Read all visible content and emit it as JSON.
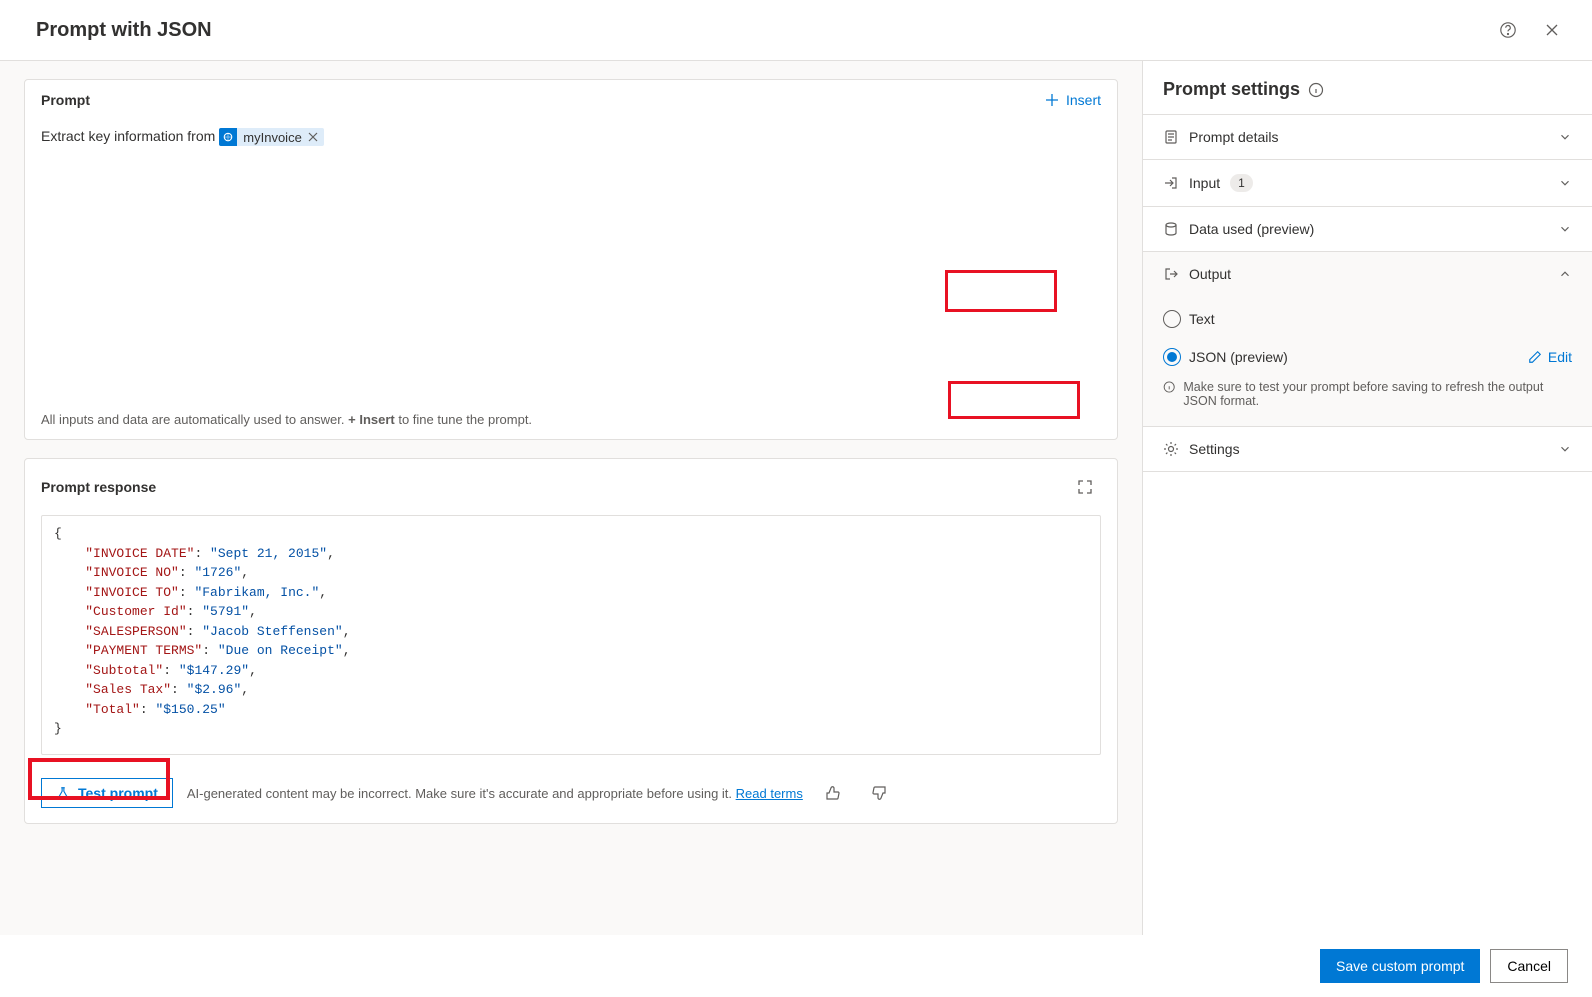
{
  "header": {
    "title": "Prompt with JSON"
  },
  "promptCard": {
    "title": "Prompt",
    "insertLabel": "Insert",
    "text": "Extract key information from",
    "chipLabel": "myInvoice",
    "footerPrefix": "All inputs and data are automatically used to answer. ",
    "footerBold": "+ Insert",
    "footerSuffix": " to fine tune the prompt."
  },
  "responseCard": {
    "title": "Prompt response",
    "testLabel": "Test prompt",
    "hint": "AI-generated content may be incorrect. Make sure it's accurate and appropriate before using it. ",
    "readTerms": "Read terms",
    "json": {
      "INVOICE DATE": "Sept 21, 2015",
      "INVOICE NO": "1726",
      "INVOICE TO": "Fabrikam, Inc.",
      "Customer Id": "5791",
      "SALESPERSON": "Jacob Steffensen",
      "PAYMENT TERMS": "Due on Receipt",
      "Subtotal": "$147.29",
      "Sales Tax": "$2.96",
      "Total": "$150.25"
    }
  },
  "settingsPanel": {
    "title": "Prompt settings",
    "items": {
      "details": "Prompt details",
      "input": "Input",
      "inputCount": "1",
      "dataUsed": "Data used (preview)",
      "output": "Output",
      "settings": "Settings"
    },
    "output": {
      "textOption": "Text",
      "jsonOption": "JSON (preview)",
      "editLabel": "Edit",
      "note": "Make sure to test your prompt before saving to refresh the output JSON format."
    }
  },
  "footer": {
    "save": "Save custom prompt",
    "cancel": "Cancel"
  }
}
